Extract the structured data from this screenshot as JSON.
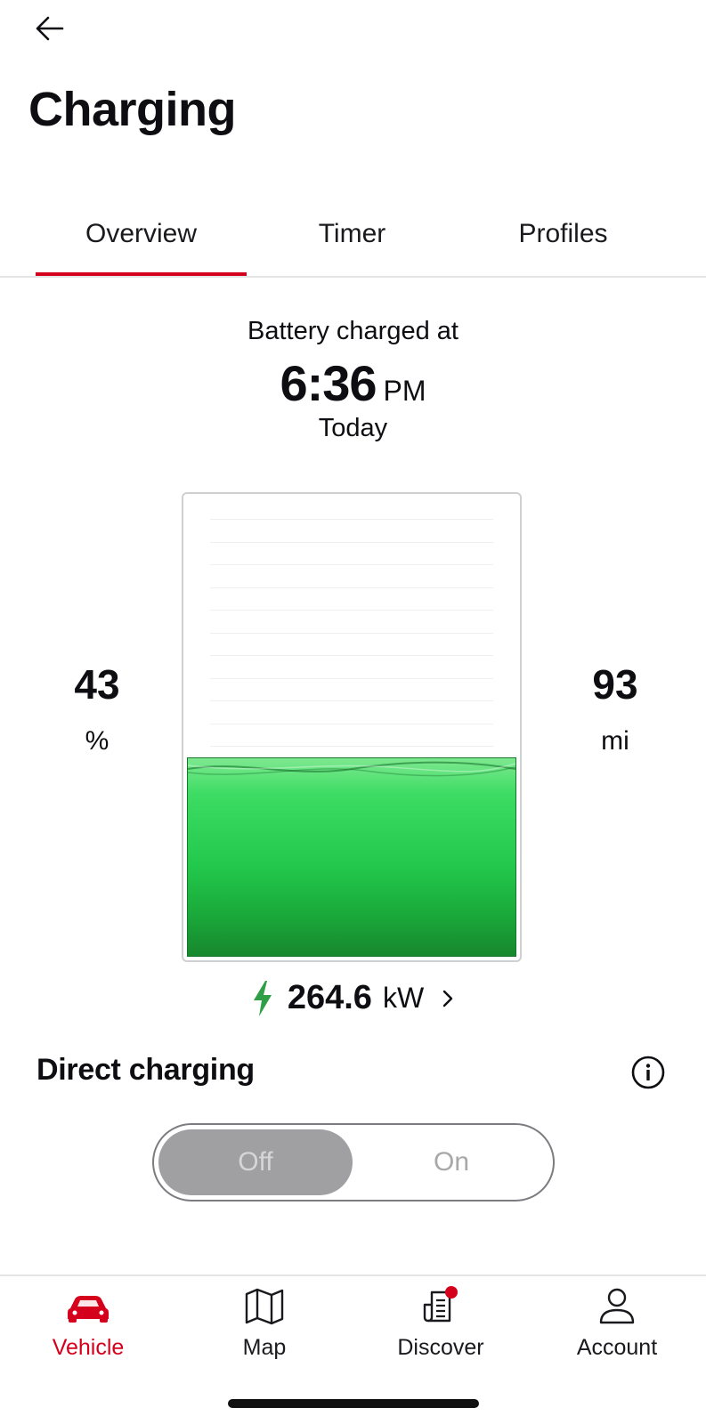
{
  "header": {
    "title": "Charging",
    "back_icon": "arrow-left-icon"
  },
  "tabs": [
    {
      "label": "Overview",
      "active": true
    },
    {
      "label": "Timer",
      "active": false
    },
    {
      "label": "Profiles",
      "active": false
    }
  ],
  "charge": {
    "label": "Battery charged at",
    "time": "6:36",
    "ampm": "PM",
    "day": "Today"
  },
  "battery": {
    "percent_value": "43",
    "percent_unit": "%",
    "range_value": "93",
    "range_unit": "mi",
    "fill_fraction": 0.43,
    "fill_color": "#22c84b"
  },
  "power": {
    "value": "264.6",
    "unit": "kW",
    "icon": "lightning-bolt-icon",
    "bolt_color": "#2e9e47"
  },
  "direct_charging": {
    "title": "Direct charging",
    "info_icon": "info-icon",
    "off_label": "Off",
    "on_label": "On",
    "selected": "Off"
  },
  "bottom_nav": [
    {
      "label": "Vehicle",
      "icon": "car-icon",
      "active": true
    },
    {
      "label": "Map",
      "icon": "map-icon",
      "active": false
    },
    {
      "label": "Discover",
      "icon": "news-icon",
      "active": false,
      "badge": true
    },
    {
      "label": "Account",
      "icon": "person-icon",
      "active": false
    }
  ],
  "colors": {
    "accent": "#d5001c",
    "text": "#0e0e12",
    "divider": "#e3e4e5"
  }
}
